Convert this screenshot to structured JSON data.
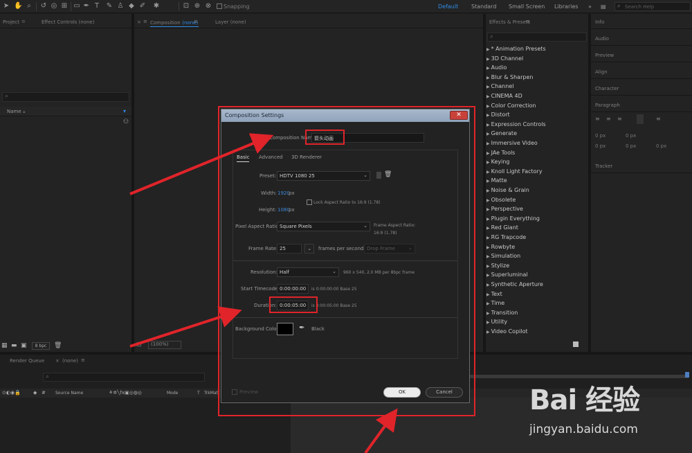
{
  "toolbar": {
    "snapping_label": "Snapping",
    "workspaces": [
      "Default",
      "Standard",
      "Small Screen",
      "Libraries"
    ],
    "search_placeholder": "Search Help"
  },
  "left_panel": {
    "tabs": [
      "Project",
      "Effect Controls (none)"
    ],
    "column_name": "Name",
    "bpc": "8 bpc"
  },
  "comp_panel": {
    "composition_tab": "Composition",
    "composition_tab_none": "(none)",
    "layer_tab": "Layer (none)"
  },
  "timeline": {
    "tabs": [
      "Render Queue",
      "(none)"
    ],
    "columns": [
      "Source Name",
      "Mode",
      "T",
      "TrkMat"
    ],
    "zoom": "(100%)"
  },
  "effects_panel": {
    "title": "Effects & Presets",
    "items": [
      "* Animation Presets",
      "3D Channel",
      "Audio",
      "Blur & Sharpen",
      "Channel",
      "CINEMA 4D",
      "Color Correction",
      "Distort",
      "Expression Controls",
      "Generate",
      "Immersive Video",
      "JAe Tools",
      "Keying",
      "Knoll Light Factory",
      "Matte",
      "Noise & Grain",
      "Obsolete",
      "Perspective",
      "Plugin Everything",
      "Red Giant",
      "RG Trapcode",
      "Rowbyte",
      "Simulation",
      "Stylize",
      "Superluminal",
      "Synthetic Aperture",
      "Text",
      "Time",
      "Transition",
      "Utility",
      "Video Copilot"
    ]
  },
  "right_panels": {
    "items": [
      "Info",
      "Audio",
      "Preview",
      "Align",
      "Character",
      "Paragraph",
      "Tracker"
    ],
    "paragraph_values": [
      "0 px",
      "0 px",
      "0 px",
      "0 px",
      "0 px"
    ]
  },
  "dialog": {
    "title": "Composition Settings",
    "comp_name_label": "Composition Name:",
    "comp_name_value": "箭头动画",
    "tabs": [
      "Basic",
      "Advanced",
      "3D Renderer"
    ],
    "preset_label": "Preset:",
    "preset_value": "HDTV 1080 25",
    "width_label": "Width:",
    "width_value": "1920",
    "height_label": "Height:",
    "height_value": "1080",
    "px": "px",
    "lock_label": "Lock Aspect Ratio to 16:9 (1.78)",
    "par_label": "Pixel Aspect Ratio:",
    "par_value": "Square Pixels",
    "frame_aspect_label": "Frame Aspect Ratio:",
    "frame_aspect_value": "16:9 (1.78)",
    "frame_rate_label": "Frame Rate:",
    "frame_rate_value": "25",
    "fps_label": "frames per second",
    "drop_frame": "Drop Frame",
    "resolution_label": "Resolution:",
    "resolution_value": "Half",
    "resolution_note": "960 x 540, 2.0 MB per 8bpc frame",
    "start_tc_label": "Start Timecode:",
    "start_tc_value": "0:00:00:00",
    "start_tc_note": "is 0:00:00:00  Base 25",
    "duration_label": "Duration:",
    "duration_value": "0:00:05:00",
    "duration_note": "is 0:00:05:00  Base 25",
    "bg_color_label": "Background Color:",
    "bg_color_name": "Black",
    "preview_label": "Preview",
    "ok_label": "OK",
    "cancel_label": "Cancel"
  },
  "watermark": {
    "logo": "Bai 经验",
    "url": "jingyan.baidu.com"
  },
  "colors": {
    "annotation_red": "#e0242a",
    "accent_blue": "#3d8be0",
    "panel_bg": "#232323"
  }
}
